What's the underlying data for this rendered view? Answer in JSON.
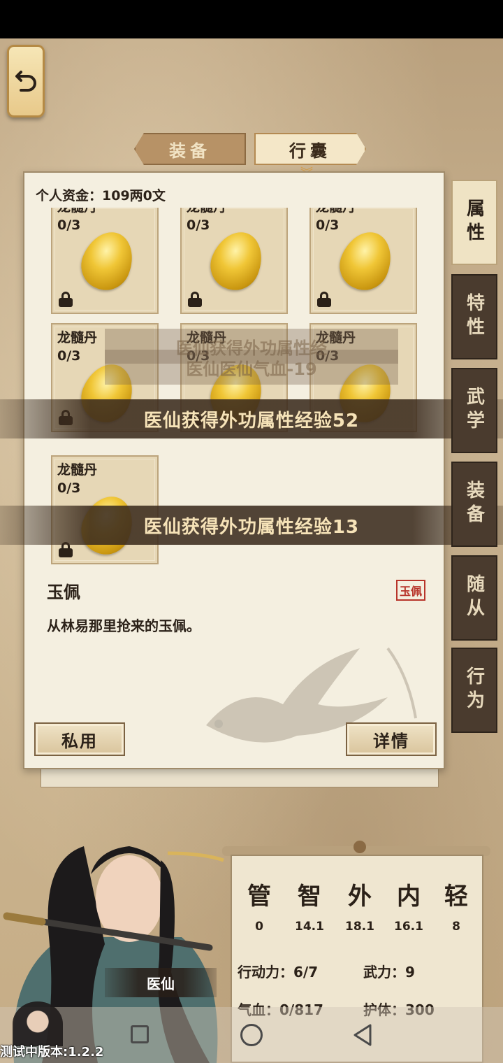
{
  "top_tabs": {
    "equip": "装备",
    "bag": "行囊"
  },
  "funds": "个人资金：109两0文",
  "slots": [
    {
      "name": "龙髓丹",
      "count": "0/3"
    },
    {
      "name": "龙髓丹",
      "count": "0/3"
    },
    {
      "name": "龙髓丹",
      "count": "0/3"
    },
    {
      "name": "龙髓丹",
      "count": "0/3"
    },
    {
      "name": "龙髓丹",
      "count": "0/3"
    },
    {
      "name": "龙髓丹",
      "count": "0/3"
    },
    {
      "name": "龙髓丹",
      "count": "0/3"
    }
  ],
  "toasts": {
    "ghost_1": "医仙获得外功属性经",
    "ghost_2": "医仙医仙气血-19",
    "toast_1": "医仙获得外功属性经验52",
    "toast_2": "医仙获得外功属性经验13"
  },
  "item": {
    "title": "玉佩",
    "tag": "玉佩",
    "description": "从林易那里抢来的玉佩。"
  },
  "buttons": {
    "private_use": "私用",
    "details": "详情"
  },
  "side_tabs": [
    "属性",
    "特性",
    "武学",
    "装备",
    "随从",
    "行为"
  ],
  "character": {
    "name": "医仙"
  },
  "stats": {
    "columns": [
      {
        "glyph": "管",
        "value": "0"
      },
      {
        "glyph": "智",
        "value": "14.1"
      },
      {
        "glyph": "外",
        "value": "18.1"
      },
      {
        "glyph": "内",
        "value": "16.1"
      },
      {
        "glyph": "轻",
        "value": "8"
      }
    ],
    "action_power": "行动力：6/7",
    "martial_power": "武力：9",
    "hp": "气血：0/817",
    "armor": "护体：300"
  },
  "version": "测试中版本:1.2.2",
  "icons": {
    "back": "back-arrow-icon",
    "lock": "lock-icon",
    "item": "golden-egg-icon"
  },
  "colors": {
    "accent_red": "#b8352b",
    "panel_bg": "#f4efe0",
    "tab_dark": "#4a3b2e"
  }
}
